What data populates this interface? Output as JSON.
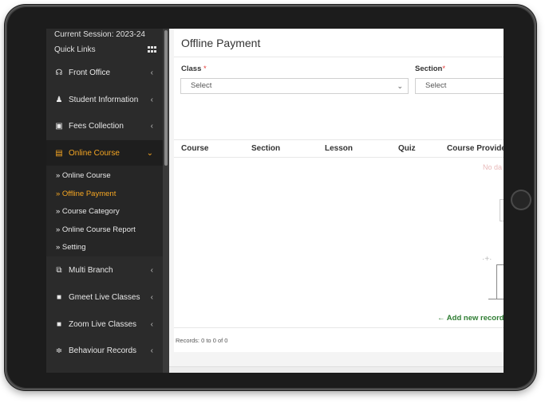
{
  "sidebar": {
    "session": "Current Session: 2023-24",
    "quick_links": "Quick Links",
    "items": [
      {
        "label": "Front Office",
        "icon": "headset-icon",
        "chevron": "‹"
      },
      {
        "label": "Student Information",
        "icon": "user-plus-icon",
        "chevron": "‹"
      },
      {
        "label": "Fees Collection",
        "icon": "money-icon",
        "chevron": "‹"
      },
      {
        "label": "Online Course",
        "icon": "book-icon",
        "chevron": "⌄"
      },
      {
        "label": "Multi Branch",
        "icon": "sitemap-icon",
        "chevron": "‹"
      },
      {
        "label": "Gmeet Live Classes",
        "icon": "video-icon",
        "chevron": "‹"
      },
      {
        "label": "Zoom Live Classes",
        "icon": "video-icon",
        "chevron": "‹"
      },
      {
        "label": "Behaviour Records",
        "icon": "sliders-icon",
        "chevron": "‹"
      }
    ],
    "submenu": [
      "» Online Course",
      "» Offline Payment",
      "» Course Category",
      "» Online Course Report",
      "» Setting"
    ]
  },
  "main": {
    "title": "Offline Payment",
    "class_label": "Class",
    "section_label": "Section",
    "required_mark": "*",
    "class_select": "Select",
    "section_select": "Select",
    "columns": [
      "Course",
      "Section",
      "Lesson",
      "Quiz",
      "Course Provider"
    ],
    "no_data": "No da",
    "add_record": "← Add new record",
    "records": "Records: 0 to 0 of 0"
  },
  "colors": {
    "sidebar_bg": "#2b2b2b",
    "accent": "#f5a623",
    "add_record": "#2e7d32",
    "required": "#e53935"
  }
}
